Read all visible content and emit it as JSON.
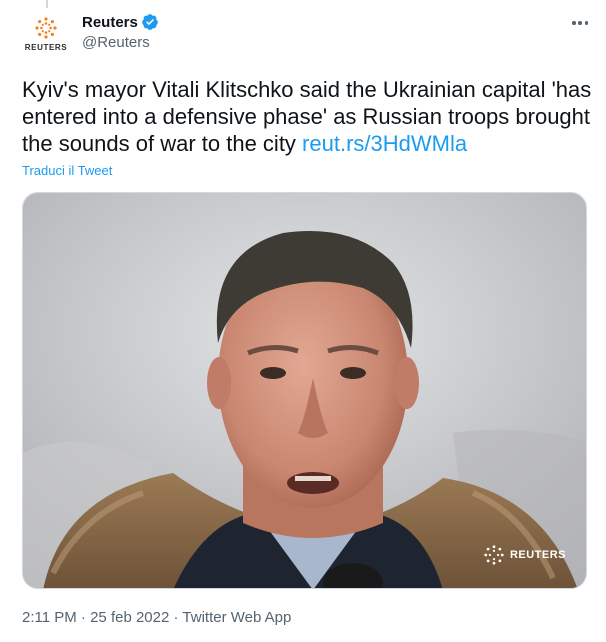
{
  "account": {
    "display_name": "Reuters",
    "handle": "@Reuters",
    "avatar_label": "REUTERS",
    "verified": true
  },
  "tweet": {
    "text": "Kyiv's mayor Vitali Klitschko said the Ukrainian capital 'has entered into a defensive phase' as Russian troops brought the sounds of war to the city ",
    "link": "reut.rs/3HdWMla",
    "translate_label": "Traduci il Tweet"
  },
  "media": {
    "watermark": "REUTERS",
    "description_icon": "photo"
  },
  "meta": {
    "time": "2:11 PM",
    "separator": "·",
    "date": "25 feb 2022",
    "source": "Twitter Web App"
  },
  "colors": {
    "link": "#1d9bf0",
    "verified": "#1d9bf0",
    "brand": "#f58220",
    "secondary_text": "#536471"
  }
}
